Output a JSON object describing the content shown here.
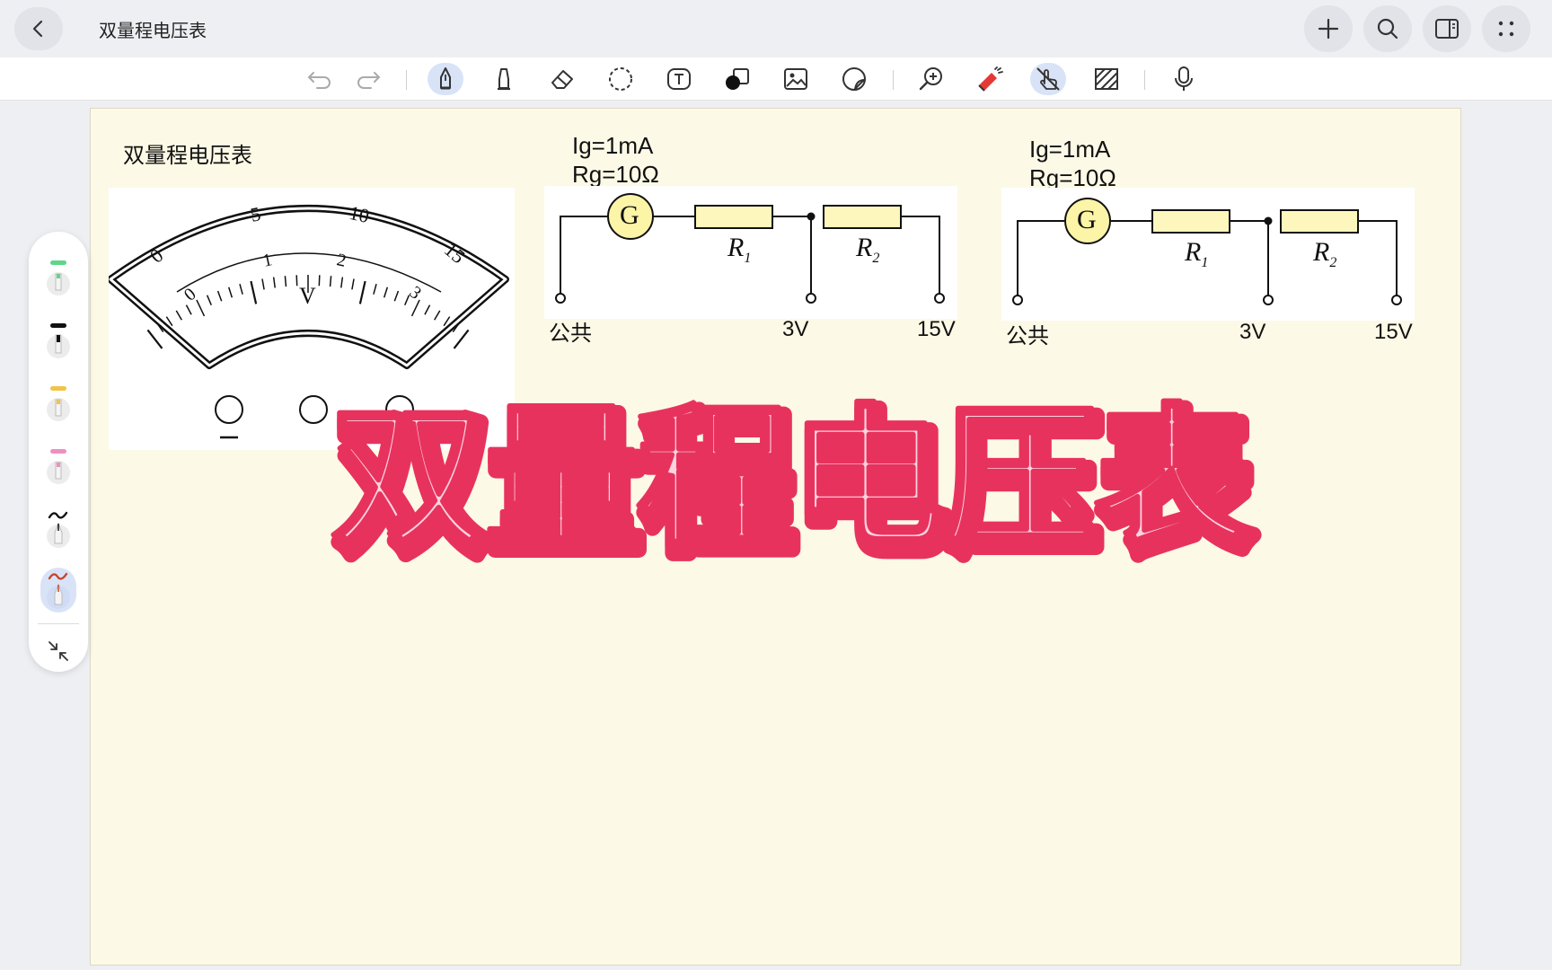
{
  "app": {
    "document_title": "双量程电压表"
  },
  "toolbar": {
    "tools": [
      "undo-icon",
      "redo-icon",
      "pen-icon",
      "highlighter-icon",
      "eraser-icon",
      "lasso-icon",
      "text-icon",
      "shape-icon",
      "image-icon",
      "sticker-icon",
      "zoom-icon",
      "laser-pointer-icon",
      "hand-touch-icon",
      "hatch-icon",
      "microphone-icon"
    ],
    "active": [
      "pen-icon",
      "hand-touch-icon"
    ]
  },
  "palette": {
    "pens": [
      {
        "name": "green-highlighter",
        "color": "#5fd68a"
      },
      {
        "name": "black-marker",
        "color": "#111111"
      },
      {
        "name": "yellow-highlighter",
        "color": "#f2c24b"
      },
      {
        "name": "pink-highlighter",
        "color": "#ef8fc0"
      },
      {
        "name": "black-pen",
        "color": "#111111"
      },
      {
        "name": "red-pen",
        "color": "#c8452c"
      }
    ]
  },
  "canvas": {
    "heading": "双量程电压表",
    "meter": {
      "upper_scale": [
        "0",
        "5",
        "10",
        "15"
      ],
      "lower_scale": [
        "0",
        "1",
        "2",
        "3"
      ],
      "unit": "V",
      "terminal_minus": "−"
    },
    "circuit_left": {
      "ig": "Ig=1mA",
      "rg": "Rg=10Ω",
      "galvanometer": "G",
      "r1": "R",
      "r1_sub": "1",
      "r2": "R",
      "r2_sub": "2",
      "common": "公共",
      "range_low": "3V",
      "range_high": "15V"
    },
    "circuit_right": {
      "ig": "Ig=1mA",
      "rg": "Rg=10Ω",
      "galvanometer": "G",
      "r1": "R",
      "r1_sub": "1",
      "r2": "R",
      "r2_sub": "2",
      "common": "公共",
      "range_low": "3V",
      "range_high": "15V"
    },
    "overlay_title": "双量程电压表",
    "colors": {
      "overlay_fill": "#fbd3de",
      "overlay_stroke": "#e8325e",
      "resistor_fill": "#fdf7bd",
      "galvanometer_fill": "#fcf4a6"
    }
  }
}
